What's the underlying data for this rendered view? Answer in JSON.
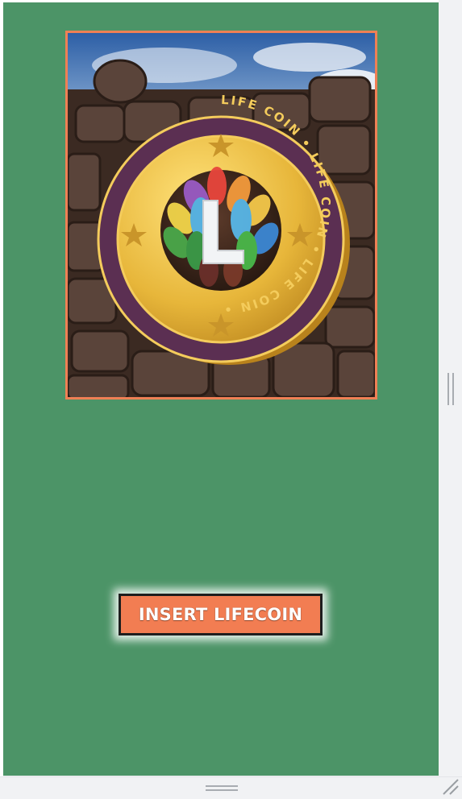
{
  "stage": {
    "background_color": "#4c9467"
  },
  "coin_image": {
    "ring_text": "LIFE COIN • LIFE COIN • LIFE COIN •",
    "frame_color": "#ef8055",
    "coin_color": "#e7b63a",
    "ring_color": "#5b2f52"
  },
  "insert_button": {
    "label": "INSERT LIFECOIN",
    "background_color": "#f27d52"
  },
  "chrome": {
    "right_handle": "vertical-resize-handle",
    "bottom_handle": "horizontal-resize-handle",
    "corner_grip": "resize-grip-icon"
  }
}
